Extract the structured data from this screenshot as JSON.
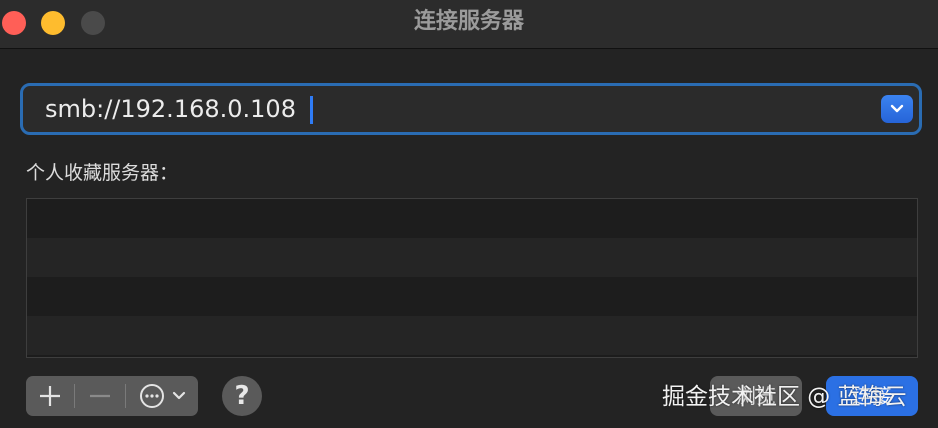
{
  "window": {
    "title": "连接服务器"
  },
  "address": {
    "value": "smb://192.168.0.108"
  },
  "favorites": {
    "label": "个人收藏服务器：",
    "rows": 4
  },
  "buttons": {
    "help_label": "?",
    "browse_label": "浏览",
    "connect_label": "连接"
  },
  "watermark": {
    "text": "掘金技术社区 @ 蓝梅云"
  },
  "icons": {
    "add": "plus-icon",
    "remove": "minus-icon",
    "more": "ellipsis-circle-icon",
    "chevron": "chevron-down-icon"
  },
  "colors": {
    "accent": "#2b70e4",
    "focus_ring": "#2a6cb3",
    "close": "#ff5f57",
    "minimize": "#febc2e"
  }
}
